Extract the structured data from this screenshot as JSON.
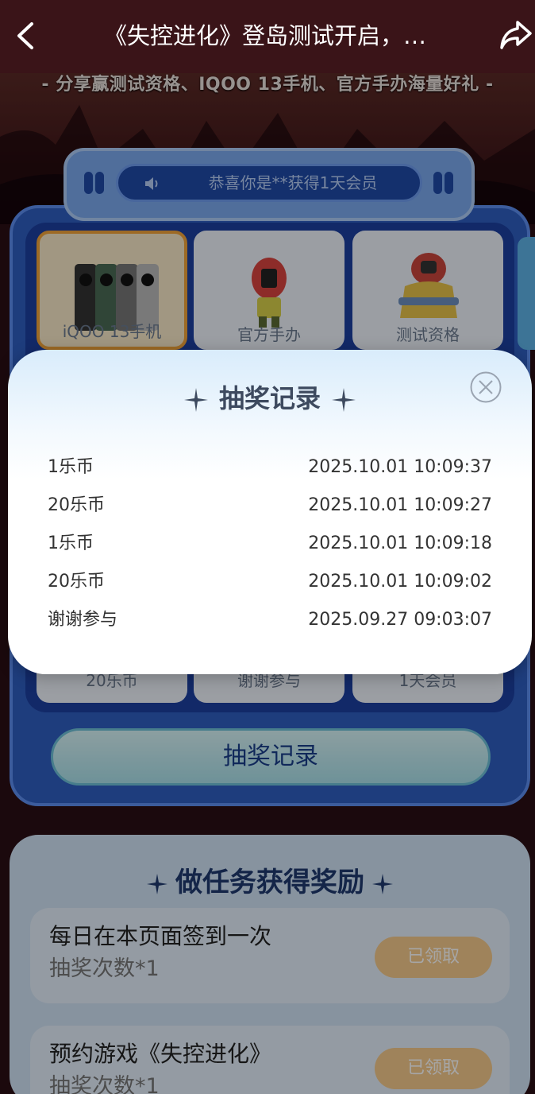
{
  "nav": {
    "title": "《失控进化》登岛测试开启，…"
  },
  "hero": {
    "banner_text": "- 分享赢测试资格、IQOO 13手机、官方手办海量好礼 -"
  },
  "ticker": {
    "text": "恭喜你是**获得1天会员"
  },
  "prizes_top": [
    {
      "label": "iQOO 13手机"
    },
    {
      "label": "官方手办"
    },
    {
      "label": "测试资格"
    }
  ],
  "prizes_bottom": [
    {
      "label": "20乐币"
    },
    {
      "label": "谢谢参与"
    },
    {
      "label": "1天会员"
    }
  ],
  "record_button": {
    "label": "抽奖记录"
  },
  "tasks": {
    "title": "做任务获得奖励",
    "items": [
      {
        "name": "每日在本页面签到一次",
        "sub": "抽奖次数*1",
        "button": "已领取"
      },
      {
        "name": "预约游戏《失控进化》",
        "sub": "抽奖次数*1",
        "button": "已领取"
      }
    ]
  },
  "modal": {
    "title": "抽奖记录",
    "records": [
      {
        "prize": "1乐币",
        "time": "2025.10.01 10:09:37"
      },
      {
        "prize": "20乐币",
        "time": "2025.10.01 10:09:27"
      },
      {
        "prize": "1乐币",
        "time": "2025.10.01 10:09:18"
      },
      {
        "prize": "20乐币",
        "time": "2025.10.01 10:09:02"
      },
      {
        "prize": "谢谢参与",
        "time": "2025.09.27 09:03:07"
      }
    ]
  },
  "colors": {
    "board_blue": "#2f5fc0",
    "active_card_border": "#f2a43a",
    "task_button": "#f4c98c"
  }
}
